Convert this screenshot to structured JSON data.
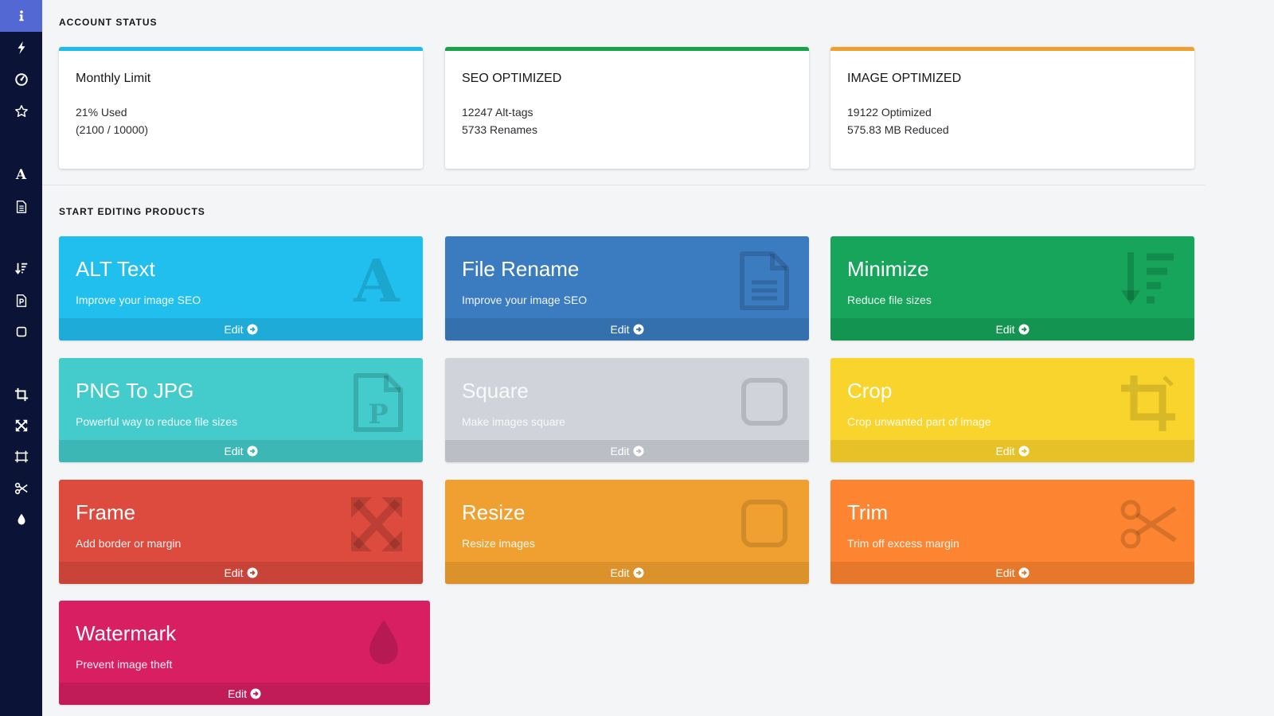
{
  "sidebar": {
    "items": [
      {
        "icon": "info-icon",
        "active": true
      },
      {
        "icon": "lightning-icon"
      },
      {
        "icon": "dashboard-icon"
      },
      {
        "icon": "star-icon"
      },
      {
        "icon": "font-icon",
        "glyph": "A"
      },
      {
        "icon": "file-text-icon"
      },
      {
        "icon": "sort-icon"
      },
      {
        "icon": "file-p-icon"
      },
      {
        "icon": "square-icon"
      },
      {
        "icon": "crop-icon"
      },
      {
        "icon": "expand-icon"
      },
      {
        "icon": "frame-icon"
      },
      {
        "icon": "scissors-icon"
      },
      {
        "icon": "tint-icon"
      }
    ]
  },
  "account_status": {
    "heading": "ACCOUNT STATUS",
    "cards": [
      {
        "title": "Monthly Limit",
        "line1": "21% Used",
        "line2": "(2100 / 10000)",
        "accent": "#1ebbea"
      },
      {
        "title": "SEO OPTIMIZED",
        "line1": "12247 Alt-tags",
        "line2": "5733 Renames",
        "accent": "#18a34a"
      },
      {
        "title": "IMAGE OPTIMIZED",
        "line1": "19122 Optimized",
        "line2": "575.83 MB Reduced",
        "accent": "#f0a030"
      }
    ]
  },
  "products": {
    "heading": "START EDITING PRODUCTS",
    "edit_label": "Edit",
    "tools": [
      {
        "title": "ALT Text",
        "subtitle": "Improve your image SEO",
        "icon": "font-icon",
        "color": "#20bfed",
        "foot": "#1eabd8"
      },
      {
        "title": "File Rename",
        "subtitle": "Improve your image SEO",
        "icon": "file-text-icon",
        "color": "#3b7cc0",
        "foot": "#3570ae"
      },
      {
        "title": "Minimize",
        "subtitle": "Reduce file sizes",
        "icon": "sort-icon",
        "color": "#16a55a",
        "foot": "#149451"
      },
      {
        "title": "PNG To JPG",
        "subtitle": "Powerful way to reduce file sizes",
        "icon": "file-p-icon",
        "color": "#43cccb",
        "foot": "#3cb7b6"
      },
      {
        "title": "Square",
        "subtitle": "Make images square",
        "icon": "square-icon",
        "color": "#d0d3da",
        "foot": "#bbbec4"
      },
      {
        "title": "Crop",
        "subtitle": "Crop unwanted part of image",
        "icon": "crop-icon",
        "color": "#f9d42d",
        "foot": "#e6c228"
      },
      {
        "title": "Frame",
        "subtitle": "Add border or margin",
        "icon": "expand-icon",
        "color": "#dd4b3f",
        "foot": "#c84338"
      },
      {
        "title": "Resize",
        "subtitle": "Resize images",
        "icon": "square-icon",
        "color": "#f0a030",
        "foot": "#dc922b"
      },
      {
        "title": "Trim",
        "subtitle": "Trim off excess margin",
        "icon": "scissors-icon",
        "color": "#fd8531",
        "foot": "#e6782c"
      },
      {
        "title": "Watermark",
        "subtitle": "Prevent image theft",
        "icon": "tint-icon",
        "color": "#d81f62",
        "foot": "#c21c58"
      }
    ]
  }
}
